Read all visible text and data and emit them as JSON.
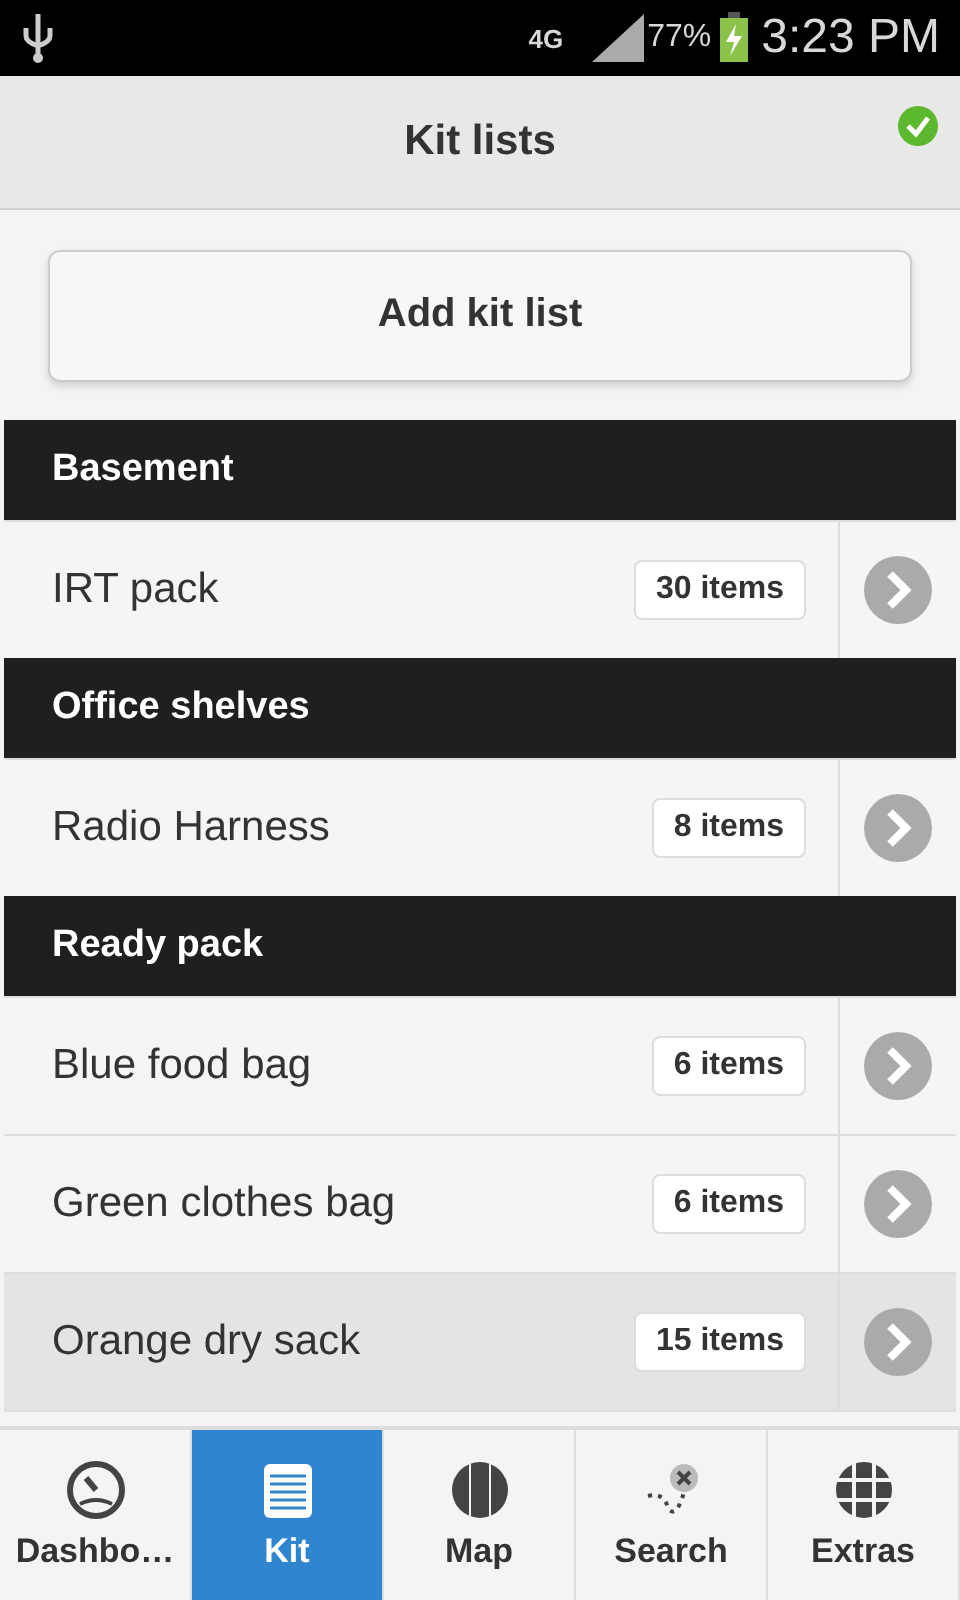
{
  "status_bar": {
    "network": "4G",
    "battery": "77%",
    "time": "3:23 PM"
  },
  "header": {
    "title": "Kit lists",
    "synced": true
  },
  "add_button": "Add kit list",
  "groups": [
    {
      "name": "Basement",
      "rows": [
        {
          "name": "IRT pack",
          "count": "30 items",
          "selected": false
        }
      ]
    },
    {
      "name": "Office shelves",
      "rows": [
        {
          "name": "Radio Harness",
          "count": "8 items",
          "selected": false
        }
      ]
    },
    {
      "name": "Ready pack",
      "rows": [
        {
          "name": "Blue food bag",
          "count": "6 items",
          "selected": false
        },
        {
          "name": "Green clothes bag",
          "count": "6 items",
          "selected": false
        },
        {
          "name": "Orange dry sack",
          "count": "15 items",
          "selected": true
        }
      ]
    }
  ],
  "tabs": [
    {
      "label": "Dashbo…",
      "kind": "gauge",
      "selected": false
    },
    {
      "label": "Kit",
      "kind": "notepad",
      "selected": true
    },
    {
      "label": "Map",
      "kind": "map",
      "selected": false
    },
    {
      "label": "Search",
      "kind": "route",
      "selected": false
    },
    {
      "label": "Extras",
      "kind": "grid",
      "selected": false
    }
  ]
}
